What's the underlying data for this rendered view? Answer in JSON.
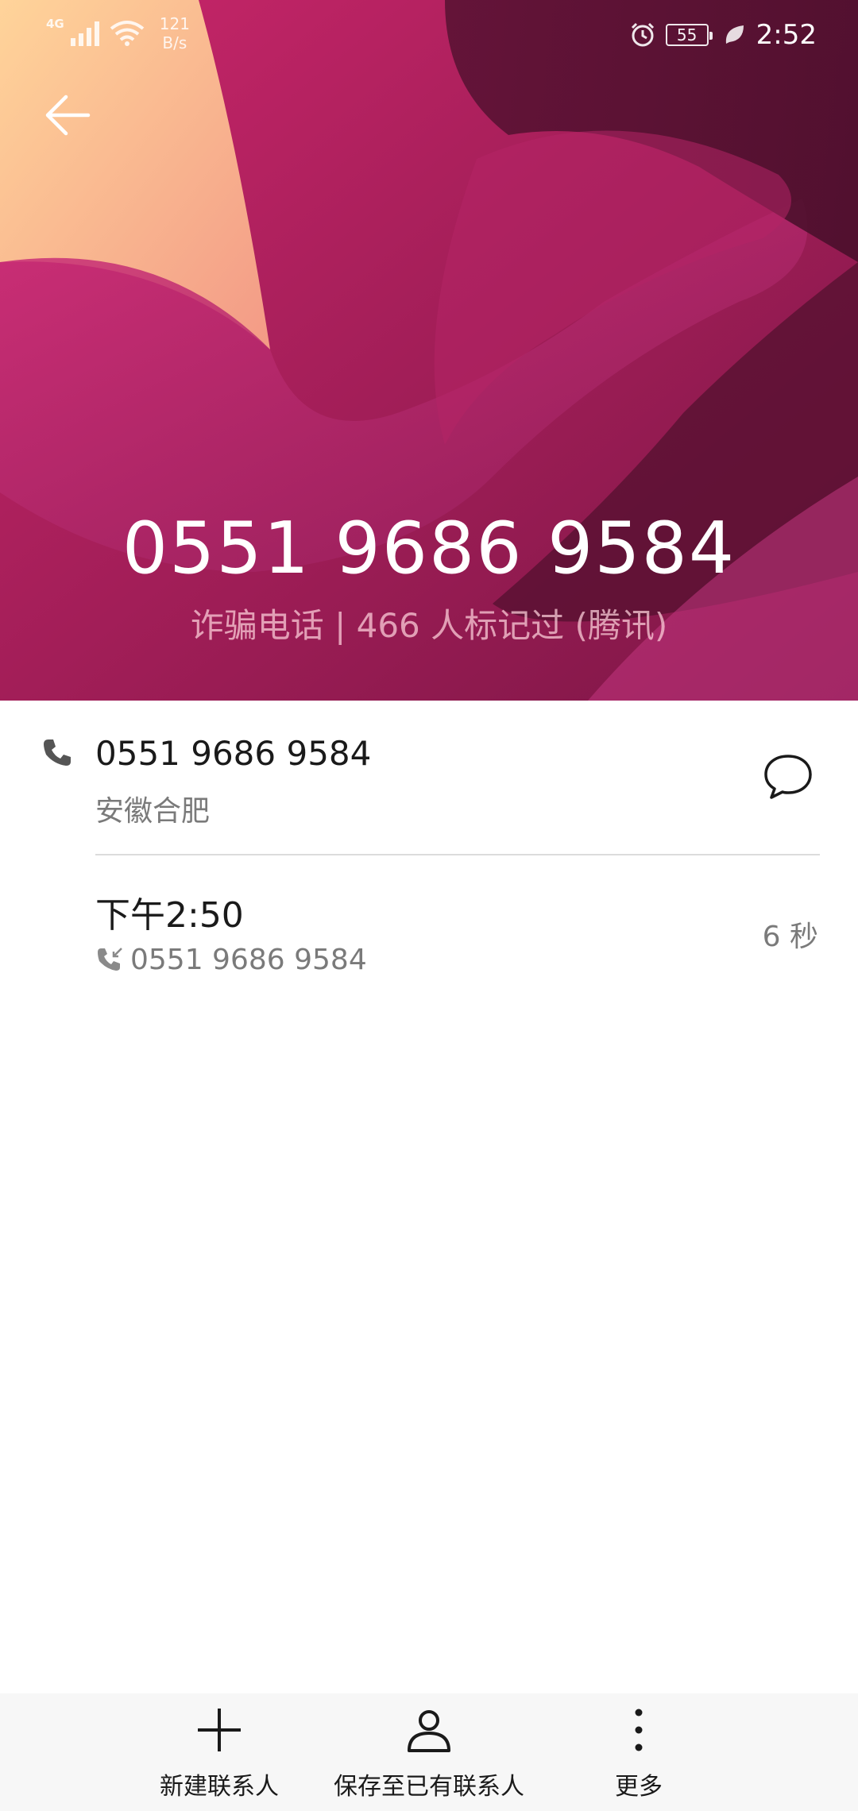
{
  "status_bar": {
    "network": "4G",
    "speed_value": "121",
    "speed_unit": "B/s",
    "battery": "55",
    "time": "2:52"
  },
  "header": {
    "phone_number": "0551 9686 9584",
    "tag_line": "诈骗电话 | 466 人标记过 (腾讯)"
  },
  "detail": {
    "phone_number": "0551 9686 9584",
    "location": "安徽合肥"
  },
  "call_log": {
    "time": "下午2:50",
    "number": "0551 9686 9584",
    "duration": "6 秒"
  },
  "bottom_bar": {
    "new_contact": "新建联系人",
    "save_existing": "保存至已有联系人",
    "more": "更多"
  },
  "colors": {
    "header_dark": "#7a1644",
    "header_light": "#f7b78f",
    "text_primary": "#1a1a1a",
    "text_secondary": "#7a7a7a"
  },
  "icons": {
    "back": "arrow-left-icon",
    "phone": "phone-icon",
    "message": "message-icon",
    "incoming_call": "incoming-call-icon",
    "add": "plus-icon",
    "person": "person-icon",
    "more": "more-vertical-icon"
  }
}
